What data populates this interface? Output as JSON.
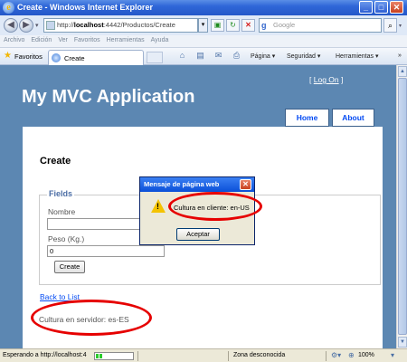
{
  "window": {
    "title": "Create - Windows Internet Explorer",
    "min_symbol": "_",
    "max_symbol": "□",
    "close_symbol": "✕"
  },
  "address_bar": {
    "url_prefix": "http://",
    "url_host": "localhost",
    "url_rest": ":4442/Productos/Create",
    "search_placeholder": "Google"
  },
  "menu_bar": {
    "items": [
      "Archivo",
      "Edición",
      "Ver",
      "Favoritos",
      "Herramientas",
      "Ayuda"
    ]
  },
  "favorites_bar": {
    "favorites_label": "Favoritos",
    "tab_label": "Create",
    "command_page": "Página ▾",
    "command_security": "Seguridad ▾",
    "command_tools": "Herramientas ▾",
    "overflow": "»"
  },
  "site": {
    "login_open": "[ ",
    "login_link": "Log On",
    "login_close": " ]",
    "app_title": "My MVC Application",
    "menu_home": "Home",
    "menu_about": "About"
  },
  "form": {
    "heading": "Create",
    "legend": "Fields",
    "label_nombre": "Nombre",
    "value_nombre": "",
    "label_peso": "Peso (Kg.)",
    "value_peso": "0",
    "submit": "Create",
    "back_link": "Back to List",
    "culture_server": "Cultura en servidor: es-ES"
  },
  "dialog": {
    "title": "Mensaje de página web",
    "message": "Cultura en cliente: en-US",
    "button": "Aceptar",
    "icon": "warning-icon"
  },
  "status_bar": {
    "text": "Esperando a http://localhost:4",
    "zone": "Zona desconocida",
    "zoom": "100%",
    "progress": 0.2
  },
  "colors": {
    "site_background": "#5c87b2",
    "annotation_red": "#e60000",
    "link_blue": "#034af3"
  }
}
